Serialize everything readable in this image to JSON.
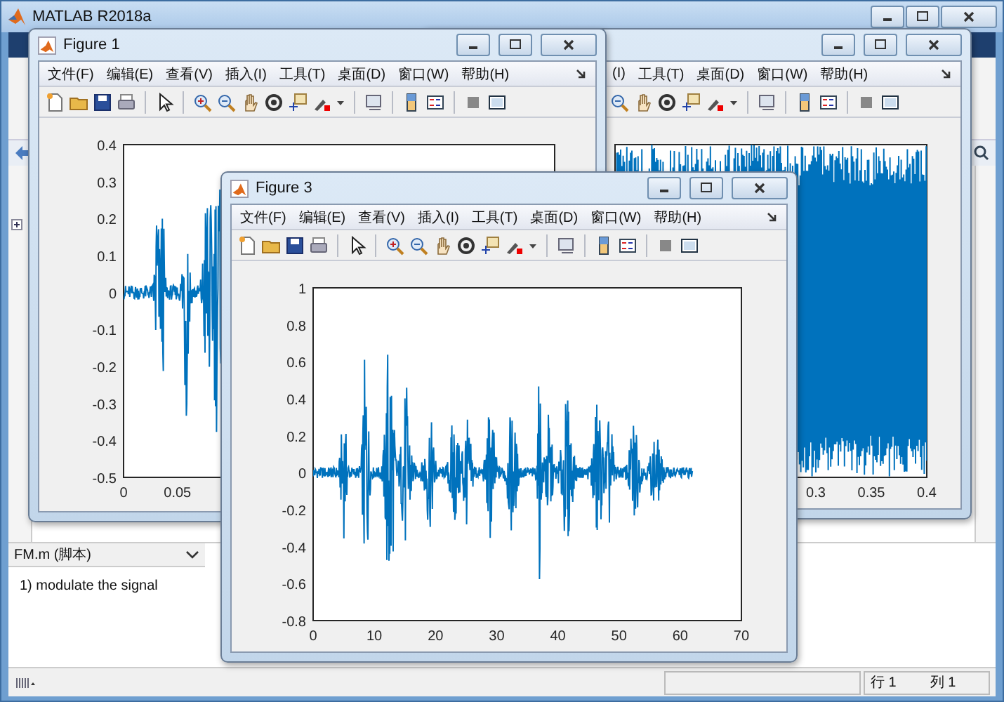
{
  "window": {
    "title": "MATLAB R2018a"
  },
  "figures": [
    {
      "title": "Figure 1",
      "menu": [
        "文件(F)",
        "编辑(E)",
        "查看(V)",
        "插入(I)",
        "工具(T)",
        "桌面(D)",
        "窗口(W)",
        "帮助(H)"
      ],
      "plot": {
        "yticks": [
          "0.4",
          "0.3",
          "0.2",
          "0.1",
          "0",
          "-0.1",
          "-0.2",
          "-0.3",
          "-0.4",
          "-0.5"
        ],
        "xticks": [
          "0",
          "0.05"
        ]
      }
    },
    {
      "menu": [
        "(I)",
        "工具(T)",
        "桌面(D)",
        "窗口(W)",
        "帮助(H)"
      ],
      "plot": {
        "xticks": [
          "0.3",
          "0.35",
          "0.4"
        ]
      }
    },
    {
      "title": "Figure 3",
      "menu": [
        "文件(F)",
        "编辑(E)",
        "查看(V)",
        "插入(I)",
        "工具(T)",
        "桌面(D)",
        "窗口(W)",
        "帮助(H)"
      ],
      "plot": {
        "yticks": [
          "1",
          "0.8",
          "0.6",
          "0.4",
          "0.2",
          "0",
          "-0.2",
          "-0.4",
          "-0.6",
          "-0.8"
        ],
        "xticks": [
          "0",
          "10",
          "20",
          "30",
          "40",
          "50",
          "60",
          "70"
        ]
      }
    }
  ],
  "editor": {
    "file_label": "FM.m  (脚本)",
    "text": "1) modulate the signal"
  },
  "status_bar": {
    "row": "行  1",
    "col": "列  1"
  }
}
